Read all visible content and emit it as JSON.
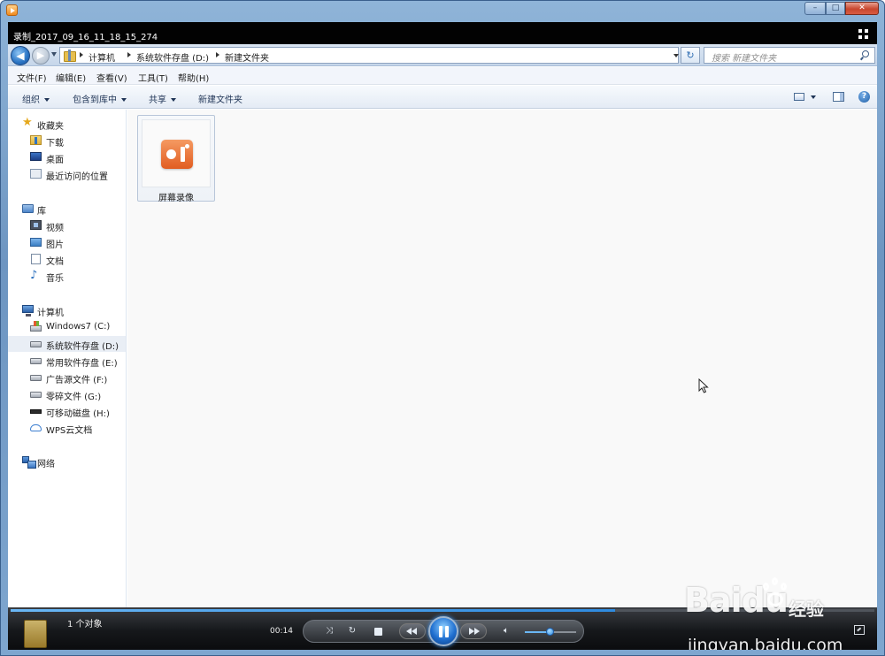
{
  "video_title": "录制_2017_09_16_11_18_15_274",
  "window_buttons": {
    "minimize": "–",
    "maximize": "□",
    "close": "✕"
  },
  "address": {
    "crumbs": [
      "计算机",
      "系统软件存盘 (D:)",
      "新建文件夹"
    ],
    "search_placeholder": "搜索 新建文件夹"
  },
  "menu": [
    "文件(F)",
    "编辑(E)",
    "查看(V)",
    "工具(T)",
    "帮助(H)"
  ],
  "commands": {
    "organize": "组织",
    "include_library": "包含到库中",
    "share": "共享",
    "new_folder": "新建文件夹"
  },
  "nav": {
    "favorites": "收藏夹",
    "downloads": "下载",
    "desktop": "桌面",
    "recent": "最近访问的位置",
    "libraries": "库",
    "videos": "视频",
    "pictures": "图片",
    "documents": "文档",
    "music": "音乐",
    "computer": "计算机",
    "drives": [
      "Windows7 (C:)",
      "系统软件存盘 (D:)",
      "常用软件存盘 (E:)",
      "广告源文件 (F:)",
      "零碎文件 (G:)",
      "可移动磁盘 (H:)"
    ],
    "wps": "WPS云文档",
    "network": "网络"
  },
  "content": {
    "item_label": "屏幕录像"
  },
  "player": {
    "status": "1 个对象",
    "time": "00:14",
    "seek_progress": 0.7,
    "volume": 0.5
  },
  "watermark": {
    "logo": "Baidu",
    "jy": "经验",
    "url": "jingyan.baidu.com"
  },
  "icons": {
    "app": "media-player-icon",
    "grid": "switch-to-library-icon",
    "back": "back-arrow-icon",
    "forward": "forward-arrow-icon",
    "refresh": "refresh-icon",
    "search": "search-icon",
    "help": "help-icon",
    "recording": "screen-recorder-icon"
  },
  "colors": {
    "accent": "#2f8be0",
    "selection": "#e9eef5"
  }
}
